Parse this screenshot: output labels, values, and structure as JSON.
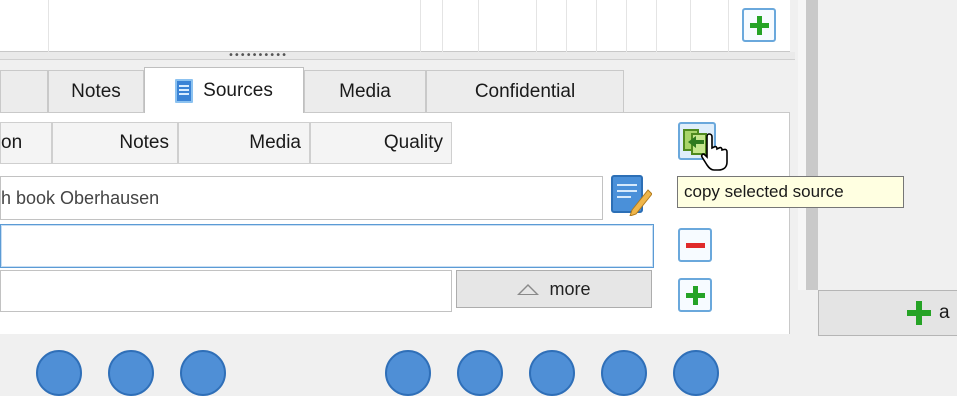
{
  "tabs": [
    {
      "label": "Notes"
    },
    {
      "label": "Sources"
    },
    {
      "label": "Media"
    },
    {
      "label": "Confidential"
    }
  ],
  "columns": [
    {
      "label": "on"
    },
    {
      "label": "Notes"
    },
    {
      "label": "Media"
    },
    {
      "label": "Quality"
    }
  ],
  "source_field": {
    "value": "h book Oberhausen"
  },
  "more_button": {
    "label": "more"
  },
  "tooltip": {
    "text": "copy selected source"
  },
  "add_button": {
    "label": "a"
  },
  "colors": {
    "accent_blue": "#6aa8dc",
    "add_green": "#26a326",
    "remove_red": "#e02a2a",
    "tooltip_bg": "#ffffe1"
  },
  "icons": [
    "plus-icon",
    "document-icon",
    "copy-source-icon",
    "hand-cursor-icon",
    "edit-icon",
    "minus-icon",
    "triangle-up-icon"
  ]
}
